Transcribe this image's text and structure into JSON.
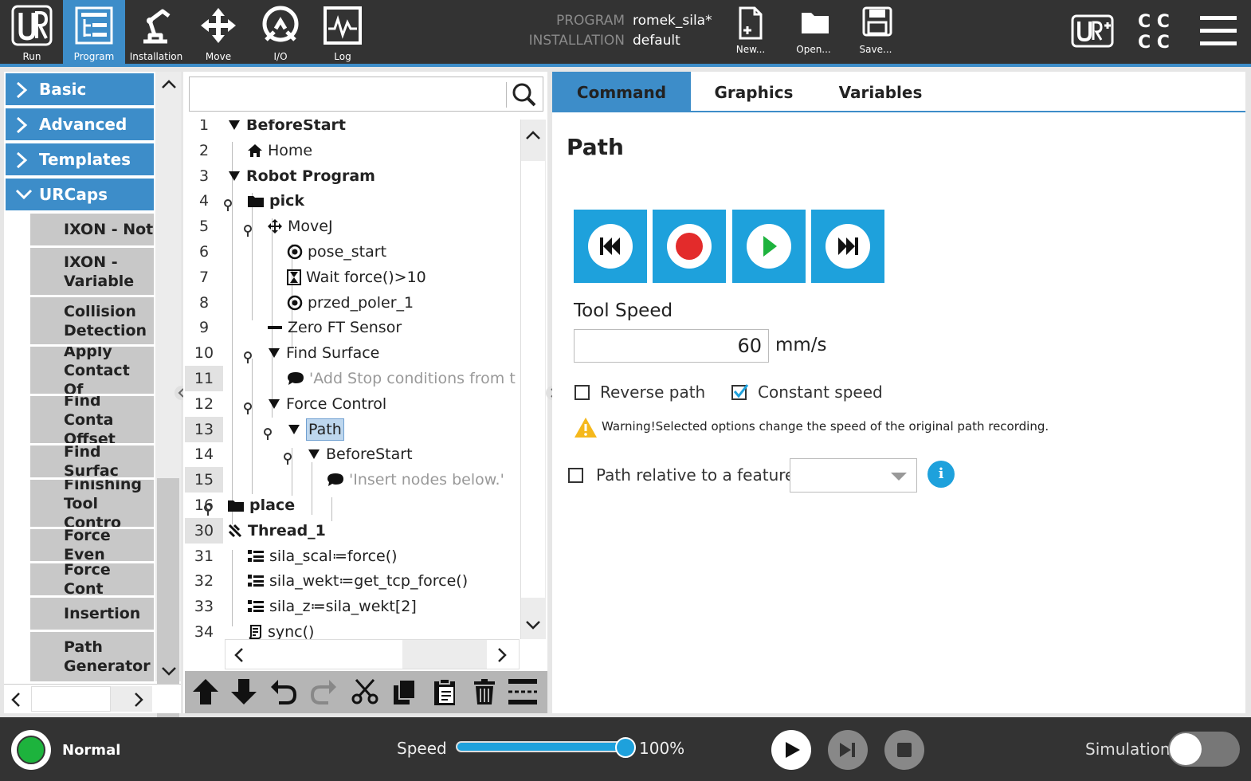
{
  "topbar": {
    "nav": [
      {
        "label": "Run",
        "icon": "ur-logo-icon"
      },
      {
        "label": "Program",
        "icon": "program-tree-icon",
        "active": true
      },
      {
        "label": "Installation",
        "icon": "robot-arm-icon"
      },
      {
        "label": "Move",
        "icon": "move-arrows-icon"
      },
      {
        "label": "I/O",
        "icon": "io-icon"
      },
      {
        "label": "Log",
        "icon": "log-chart-icon"
      }
    ],
    "program_label": "PROGRAM",
    "program_value": "romek_sila*",
    "installation_label": "INSTALLATION",
    "installation_value": "default",
    "file_buttons": [
      {
        "label": "New...",
        "icon": "new-file-icon"
      },
      {
        "label": "Open...",
        "icon": "open-folder-icon"
      },
      {
        "label": "Save...",
        "icon": "save-disk-icon"
      }
    ]
  },
  "left_panel": {
    "categories": [
      "Basic",
      "Advanced",
      "Templates",
      "URCaps"
    ],
    "urcaps_items": [
      "IXON - Not",
      "IXON -\nVariable",
      "Collision\nDetection",
      "Apply\nContact Of",
      "Find Conta\nOffset",
      "Find Surfac",
      "Finishing\nTool Contro",
      "Force Even",
      "Force Cont",
      "Insertion",
      "Path\nGenerator"
    ]
  },
  "tree": {
    "rows": [
      {
        "num": "1",
        "text": "BeforeStart",
        "icon": "collapse-arrow-icon",
        "bold": true
      },
      {
        "num": "2",
        "text": "Home",
        "icon": "home-icon"
      },
      {
        "num": "3",
        "text": "Robot Program",
        "icon": "collapse-arrow-icon",
        "bold": true
      },
      {
        "num": "4",
        "text": "pick",
        "icon": "folder-icon",
        "bold": true
      },
      {
        "num": "5",
        "text": "MoveJ",
        "icon": "move-arrows-icon"
      },
      {
        "num": "6",
        "text": "pose_start",
        "icon": "waypoint-icon"
      },
      {
        "num": "7",
        "text": "Wait force()>10",
        "icon": "hourglass-icon"
      },
      {
        "num": "8",
        "text": "przed_poler_1",
        "icon": "waypoint-icon"
      },
      {
        "num": "9",
        "text": "Zero FT Sensor",
        "icon": "dash-icon"
      },
      {
        "num": "10",
        "text": "Find Surface",
        "icon": "collapse-arrow-icon"
      },
      {
        "num": "11",
        "text": "'Add Stop conditions from t",
        "icon": "comment-icon",
        "gray": true
      },
      {
        "num": "12",
        "text": "Force Control",
        "icon": "collapse-arrow-icon"
      },
      {
        "num": "13",
        "text": "Path",
        "icon": "collapse-arrow-icon",
        "selected": true
      },
      {
        "num": "14",
        "text": "BeforeStart",
        "icon": "collapse-arrow-icon"
      },
      {
        "num": "15",
        "text": "'Insert nodes below.'",
        "icon": "comment-icon",
        "gray": true
      },
      {
        "num": "16",
        "text": "place",
        "icon": "folder-icon",
        "bold": true
      },
      {
        "num": "30",
        "text": "Thread_1",
        "icon": "thread-icon",
        "bold": true
      },
      {
        "num": "31",
        "text": "sila_scal≔force()",
        "icon": "assignment-icon"
      },
      {
        "num": "32",
        "text": "sila_wekt≔get_tcp_force()",
        "icon": "assignment-icon"
      },
      {
        "num": "33",
        "text": "sila_z≔sila_wekt[2]",
        "icon": "assignment-icon"
      },
      {
        "num": "34",
        "text": "sync()",
        "icon": "script-icon"
      }
    ]
  },
  "tabs": [
    "Command",
    "Graphics",
    "Variables"
  ],
  "command": {
    "title": "Path",
    "tool_speed_label": "Tool Speed",
    "tool_speed_value": "60",
    "tool_speed_unit": "mm/s",
    "reverse_path_label": "Reverse path",
    "reverse_path_checked": false,
    "constant_speed_label": "Constant speed",
    "constant_speed_checked": true,
    "warning_text": "Warning!Selected options change the speed of the original path recording.",
    "relative_label": "Path relative to a feature",
    "feature_value": ""
  },
  "statusbar": {
    "status": "Normal",
    "speed_label": "Speed",
    "speed_value": "100%",
    "speed_fraction": 1.0,
    "simulation_label": "Simulation",
    "simulation_on": false
  },
  "colors": {
    "accent": "#3d8dc9",
    "button_blue": "#1ea1dc",
    "record_red": "#e32b2b",
    "play_green": "#1db33d",
    "status_green": "#1db33d"
  }
}
